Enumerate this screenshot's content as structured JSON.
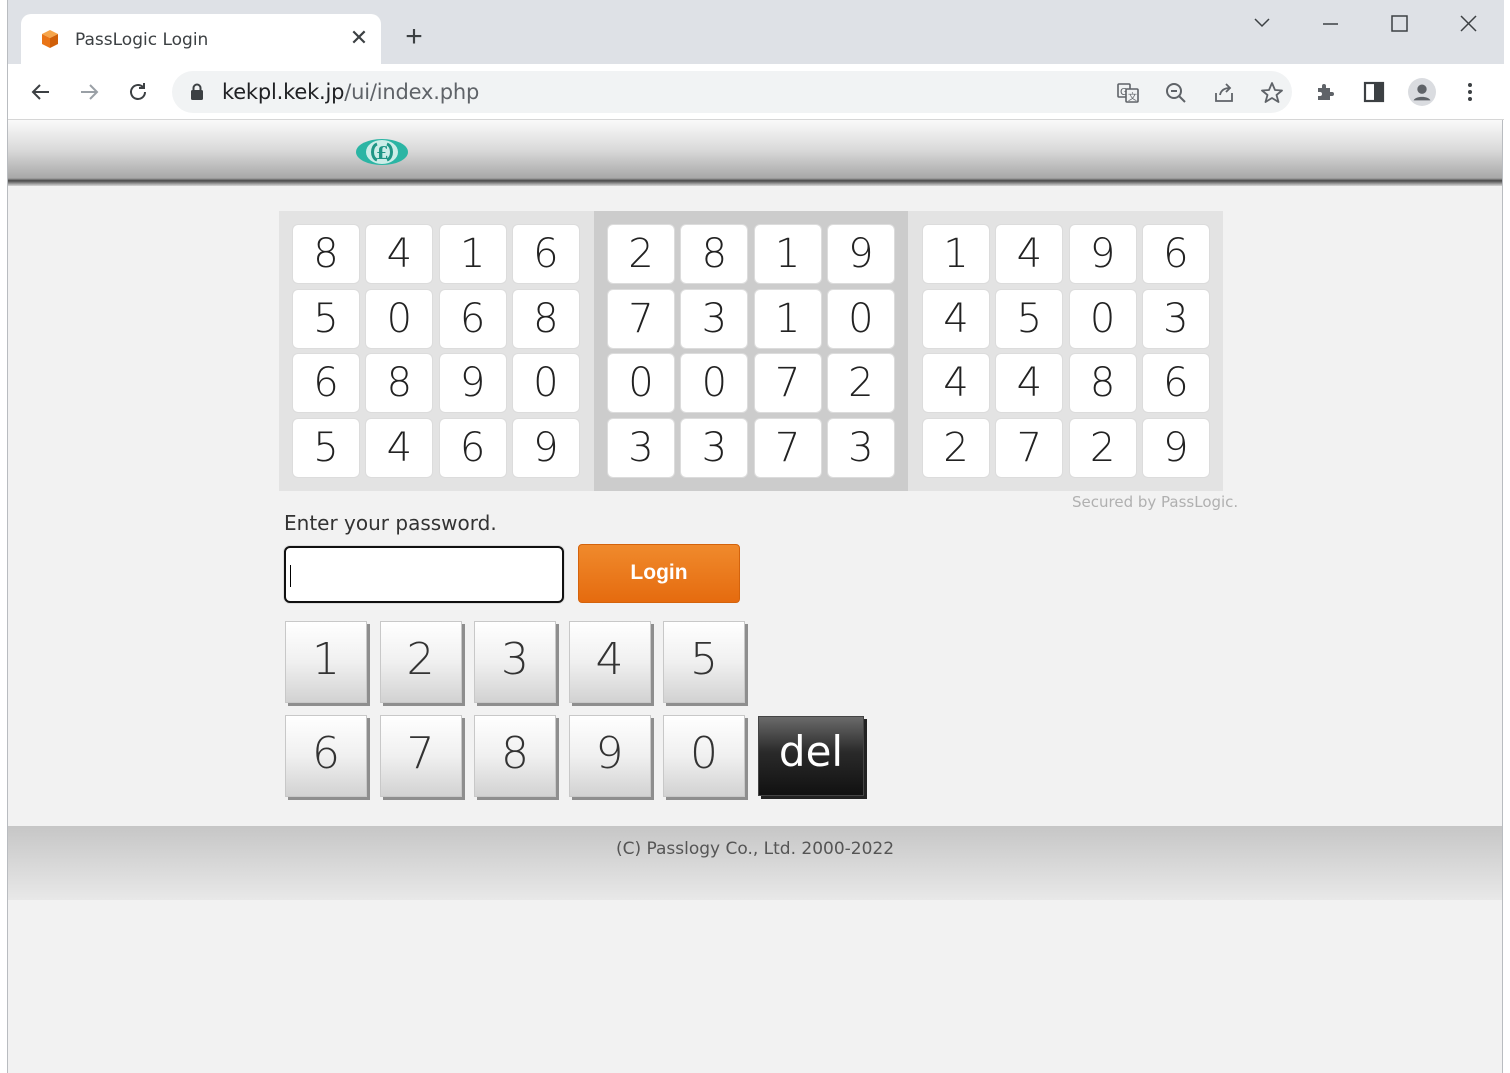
{
  "browser": {
    "tab_title": "PassLogic Login",
    "tab_close": "✕",
    "new_tab": "+",
    "url_host": "kekpl.kek.jp",
    "url_path": "/ui/index.php"
  },
  "matrix": {
    "blocks": [
      [
        [
          "8",
          "4",
          "1",
          "6"
        ],
        [
          "5",
          "0",
          "6",
          "8"
        ],
        [
          "6",
          "8",
          "9",
          "0"
        ],
        [
          "5",
          "4",
          "6",
          "9"
        ]
      ],
      [
        [
          "2",
          "8",
          "1",
          "9"
        ],
        [
          "7",
          "3",
          "1",
          "0"
        ],
        [
          "0",
          "0",
          "7",
          "2"
        ],
        [
          "3",
          "3",
          "7",
          "3"
        ]
      ],
      [
        [
          "1",
          "4",
          "9",
          "6"
        ],
        [
          "4",
          "5",
          "0",
          "3"
        ],
        [
          "4",
          "4",
          "8",
          "6"
        ],
        [
          "2",
          "7",
          "2",
          "9"
        ]
      ]
    ],
    "secured_text": "Secured by PassLogic."
  },
  "form": {
    "prompt": "Enter your password.",
    "password_value": "",
    "login_label": "Login"
  },
  "keypad": {
    "row1": [
      "1",
      "2",
      "3",
      "4",
      "5"
    ],
    "row2": [
      "6",
      "7",
      "8",
      "9",
      "0"
    ],
    "del_label": "del"
  },
  "footer": {
    "copyright": "(C) Passlogy Co., Ltd. 2000-2022"
  },
  "colors": {
    "accent_login": "#e97416",
    "logo": "#2bb5a4",
    "favicon": "#f08a24"
  }
}
